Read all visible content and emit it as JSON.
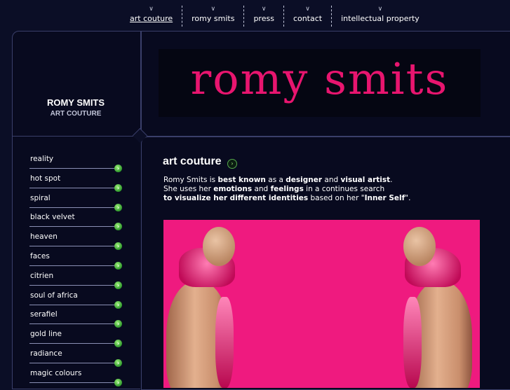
{
  "nav": {
    "items": [
      {
        "label": "art couture",
        "active": true
      },
      {
        "label": "romy smits",
        "active": false
      },
      {
        "label": "press",
        "active": false
      },
      {
        "label": "contact",
        "active": false
      },
      {
        "label": "intellectual property",
        "active": false
      }
    ],
    "chevron": "∨"
  },
  "brand": {
    "name": "ROMY SMITS",
    "subtitle": "ART COUTURE"
  },
  "logo": {
    "text": "romy smits",
    "color": "#e8156f"
  },
  "menu": {
    "items": [
      "reality",
      "hot spot",
      "spiral",
      "black velvet",
      "heaven",
      "faces",
      "citrien",
      "soul of africa",
      "serafiel",
      "gold line",
      "radiance",
      "magic colours"
    ],
    "arrow_icon": "chevron-right-icon"
  },
  "content": {
    "title": "art couture",
    "paragraph": [
      [
        {
          "t": "Romy Smits is "
        },
        {
          "t": "best known",
          "b": true
        },
        {
          "t": " as a "
        },
        {
          "t": "designer",
          "b": true
        },
        {
          "t": " and "
        },
        {
          "t": "visual artist",
          "b": true
        },
        {
          "t": "."
        }
      ],
      [
        {
          "t": "She uses her "
        },
        {
          "t": "emotions",
          "b": true
        },
        {
          "t": " and "
        },
        {
          "t": "feelings",
          "b": true
        },
        {
          "t": " in a continues search"
        }
      ],
      [
        {
          "t": "to visualize her different identities",
          "b": true
        },
        {
          "t": " based on her \""
        },
        {
          "t": "Inner Self",
          "b": true
        },
        {
          "t": "\"."
        }
      ]
    ],
    "photo_background": "#ef1a7f"
  },
  "colors": {
    "background": "#0b0e26",
    "accent": "#e8156f",
    "button_green": "#2f9a2c"
  }
}
